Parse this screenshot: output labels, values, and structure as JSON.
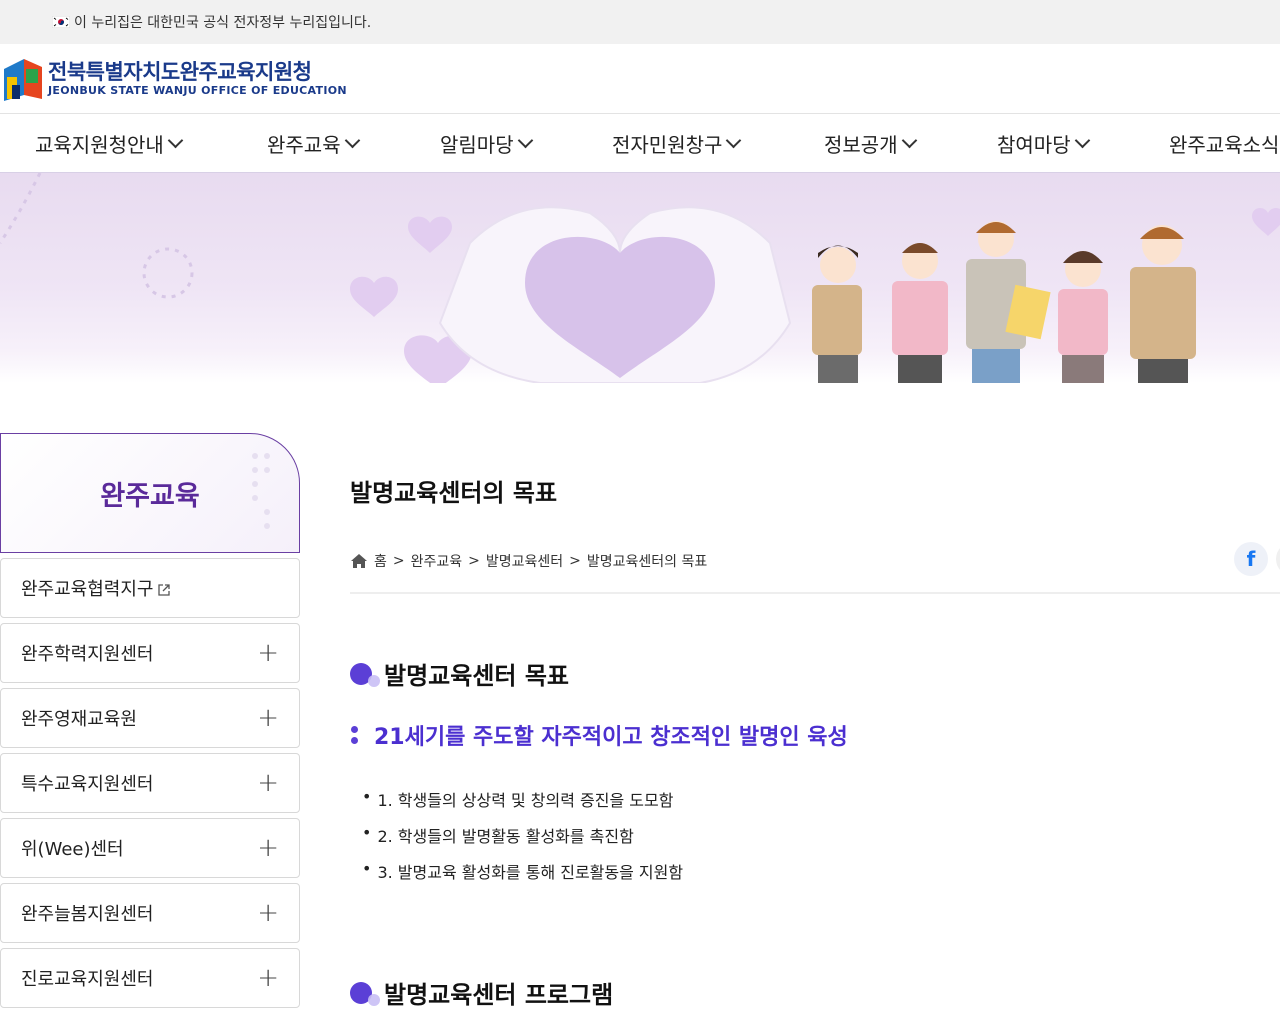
{
  "govbar": {
    "text": "이 누리집은 대한민국 공식 전자정부 누리집입니다."
  },
  "logo": {
    "title_ko": "전북특별자치도완주교육지원청",
    "title_en": "JEONBUK STATE WANJU OFFICE OF EDUCATION"
  },
  "gnb": {
    "items": [
      {
        "label": "교육지원청안내"
      },
      {
        "label": "완주교육"
      },
      {
        "label": "알림마당"
      },
      {
        "label": "전자민원창구"
      },
      {
        "label": "정보공개"
      },
      {
        "label": "참여마당"
      },
      {
        "label": "완주교육소식"
      }
    ]
  },
  "lnb": {
    "title": "완주교육",
    "items": [
      {
        "label": "완주교육협력지구",
        "external": true
      },
      {
        "label": "완주학력지원센터"
      },
      {
        "label": "완주영재교육원"
      },
      {
        "label": "특수교육지원센터"
      },
      {
        "label": "위(Wee)센터"
      },
      {
        "label": "완주늘봄지원센터"
      },
      {
        "label": "진로교육지원센터"
      }
    ],
    "plus_symbol": "+"
  },
  "main": {
    "title": "발명교육센터의 목표",
    "breadcrumb": {
      "home": "홈",
      "sep": ">",
      "items": [
        "완주교육",
        "발명교육센터",
        "발명교육센터의 목표"
      ]
    },
    "share": {
      "facebook": "f"
    },
    "section1": {
      "title": "발명교육센터 목표",
      "subtitle": "21세기를 주도할 자주적이고 창조적인 발명인 육성",
      "goals": [
        "1. 학생들의 상상력 및 창의력 증진을 도모함",
        "2. 학생들의 발명활동 활성화를 촉진함",
        "3. 발명교육 활성화를 통해 진로활동을 지원함"
      ]
    },
    "section2": {
      "title": "발명교육센터 프로그램"
    }
  },
  "colors": {
    "brand": "#1a3a8a",
    "accent": "#5b3fd6",
    "lnb_title": "#5a2a9a"
  }
}
